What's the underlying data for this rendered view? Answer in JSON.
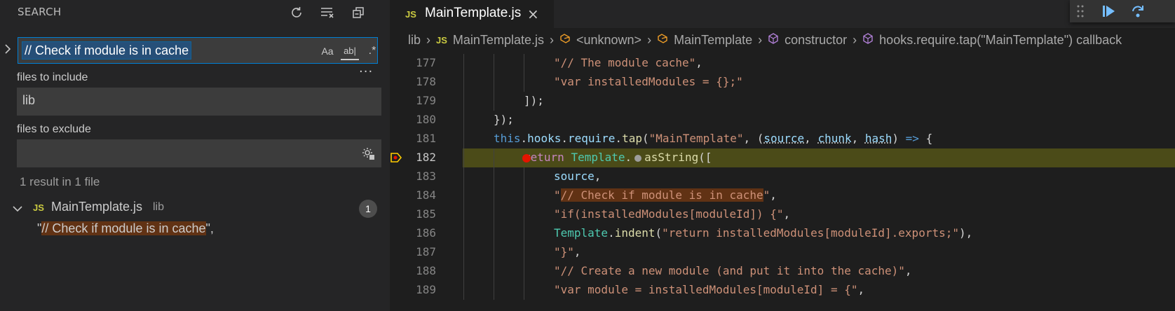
{
  "sidebar": {
    "title": "SEARCH",
    "search": {
      "query": "// Check if module is in cache",
      "match_case_label": "Aa",
      "whole_word_label": "ab|",
      "regex_label": ".*"
    },
    "files_to_include": {
      "label": "files to include",
      "value": "lib"
    },
    "files_to_exclude": {
      "label": "files to exclude",
      "value": ""
    },
    "result_summary": "1 result in 1 file",
    "results": [
      {
        "file_badge": "JS",
        "file_name": "MainTemplate.js",
        "folder": "lib",
        "count": "1",
        "match_prefix": "\"",
        "match_text": "// Check if module is in cache",
        "match_suffix": "\","
      }
    ],
    "icons": [
      "refresh-icon",
      "clear-results-icon",
      "collapse-all-icon",
      "settings-gear-icon"
    ]
  },
  "editor": {
    "tab": {
      "badge": "JS",
      "label": "MainTemplate.js",
      "close": "×"
    },
    "breadcrumb": [
      {
        "text": "lib",
        "icon": ""
      },
      {
        "text": "MainTemplate.js",
        "icon": "js-badge",
        "badge": "JS"
      },
      {
        "text": "<unknown>",
        "icon": "symbol-variable-icon"
      },
      {
        "text": "MainTemplate",
        "icon": "symbol-variable-icon"
      },
      {
        "text": "constructor",
        "icon": "symbol-method-icon"
      },
      {
        "text": "hooks.require.tap(\"MainTemplate\") callback",
        "icon": "symbol-method-icon"
      }
    ],
    "current_line": 182,
    "lines": [
      {
        "no": "177",
        "indent": 3,
        "tokens": [
          [
            "str",
            "\"// The module cache\""
          ],
          [
            "plain",
            ","
          ]
        ]
      },
      {
        "no": "178",
        "indent": 3,
        "tokens": [
          [
            "str",
            "\"var installedModules = {};\""
          ]
        ]
      },
      {
        "no": "179",
        "indent": 2,
        "tokens": [
          [
            "plain",
            "]);"
          ]
        ]
      },
      {
        "no": "180",
        "indent": 1,
        "tokens": [
          [
            "plain",
            "});"
          ]
        ]
      },
      {
        "no": "181",
        "indent": 1,
        "tokens": [
          [
            "kw",
            "this"
          ],
          [
            "plain",
            "."
          ],
          [
            "var",
            "hooks"
          ],
          [
            "plain",
            "."
          ],
          [
            "var",
            "require"
          ],
          [
            "plain",
            "."
          ],
          [
            "fn",
            "tap"
          ],
          [
            "plain",
            "("
          ],
          [
            "str",
            "\"MainTemplate\""
          ],
          [
            "plain",
            ", ("
          ],
          [
            "var-ul",
            "source"
          ],
          [
            "plain",
            ", "
          ],
          [
            "var-ul",
            "chunk"
          ],
          [
            "plain",
            ", "
          ],
          [
            "var-ul",
            "hash"
          ],
          [
            "plain",
            ") "
          ],
          [
            "kw",
            "=>"
          ],
          [
            "plain",
            " {"
          ]
        ]
      },
      {
        "no": "182",
        "indent": 2,
        "tokens": [
          [
            "ctl",
            "return"
          ],
          [
            "plain",
            " "
          ],
          [
            "cls",
            "Template"
          ],
          [
            "plain",
            "."
          ],
          [
            "bp",
            ""
          ],
          [
            "fn",
            "asString"
          ],
          [
            "plain",
            "(["
          ]
        ]
      },
      {
        "no": "183",
        "indent": 3,
        "tokens": [
          [
            "var",
            "source"
          ],
          [
            "plain",
            ","
          ]
        ]
      },
      {
        "no": "184",
        "indent": 3,
        "tokens": [
          [
            "str",
            "\""
          ],
          [
            "str-hl",
            "// Check if module is in cache"
          ],
          [
            "str",
            "\""
          ],
          [
            "plain",
            ","
          ]
        ]
      },
      {
        "no": "185",
        "indent": 3,
        "tokens": [
          [
            "str",
            "\"if(installedModules[moduleId]) {\""
          ],
          [
            "plain",
            ","
          ]
        ]
      },
      {
        "no": "186",
        "indent": 3,
        "tokens": [
          [
            "cls",
            "Template"
          ],
          [
            "plain",
            "."
          ],
          [
            "fn",
            "indent"
          ],
          [
            "plain",
            "("
          ],
          [
            "str",
            "\"return installedModules[moduleId].exports;\""
          ],
          [
            "plain",
            "),"
          ]
        ]
      },
      {
        "no": "187",
        "indent": 3,
        "tokens": [
          [
            "str",
            "\"}\""
          ],
          [
            "plain",
            ","
          ]
        ]
      },
      {
        "no": "188",
        "indent": 3,
        "tokens": [
          [
            "str",
            "\"// Create a new module (and put it into the cache)\""
          ],
          [
            "plain",
            ","
          ]
        ]
      },
      {
        "no": "189",
        "indent": 3,
        "tokens": [
          [
            "str",
            "\"var module = installedModules[moduleId] = {\""
          ],
          [
            "plain",
            ","
          ]
        ]
      }
    ]
  },
  "debug_toolbar": {
    "buttons": [
      "continue",
      "step-over"
    ]
  },
  "colors": {
    "accent": "#007fd4",
    "selection": "#264f78",
    "match": "#613214",
    "current_line": "#4b4b18",
    "breakpoint": "#e51400"
  }
}
